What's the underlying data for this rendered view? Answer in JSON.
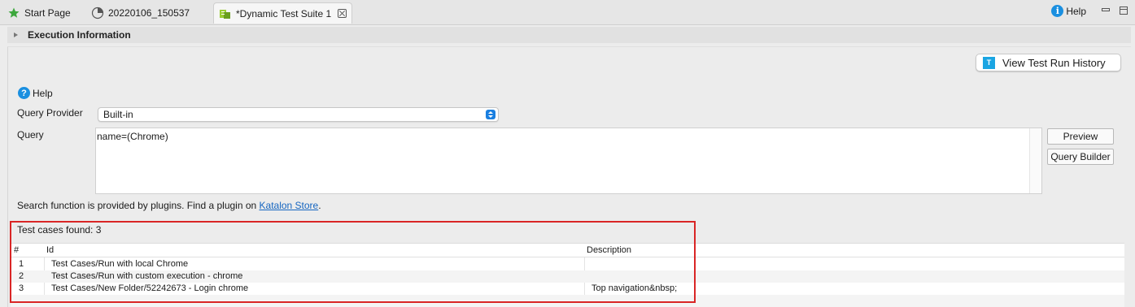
{
  "tabs": [
    {
      "label": "Start Page",
      "icon": "star-icon"
    },
    {
      "label": "20220106_150537",
      "icon": "report-icon"
    },
    {
      "label": "*Dynamic Test Suite 1",
      "icon": "test-suite-icon",
      "active": true
    }
  ],
  "top_help": {
    "label": "Help"
  },
  "section": {
    "title": "Execution Information"
  },
  "history_button": {
    "label": "View Test Run History"
  },
  "help_link": {
    "label": "Help"
  },
  "query_provider": {
    "label": "Query Provider",
    "value": "Built-in"
  },
  "query": {
    "label": "Query",
    "value": "name=(Chrome)"
  },
  "buttons": {
    "preview": "Preview",
    "query_builder": "Query Builder"
  },
  "plugin_note": {
    "text": "Search function is provided by plugins. Find a plugin on ",
    "link": "Katalon Store",
    "suffix": "."
  },
  "results": {
    "found_label": "Test cases found: 3",
    "columns": [
      "#",
      "Id",
      "Description"
    ],
    "rows": [
      {
        "num": "1",
        "id": "Test Cases/Run with local Chrome",
        "description": ""
      },
      {
        "num": "2",
        "id": "Test Cases/Run with custom execution - chrome",
        "description": ""
      },
      {
        "num": "3",
        "id": "Test Cases/New Folder/52242673 - Login chrome",
        "description": "Top navigation&nbsp;"
      }
    ]
  },
  "colors": {
    "accent": "#1a8fe0",
    "link": "#1565c0",
    "highlight": "#d92525"
  }
}
